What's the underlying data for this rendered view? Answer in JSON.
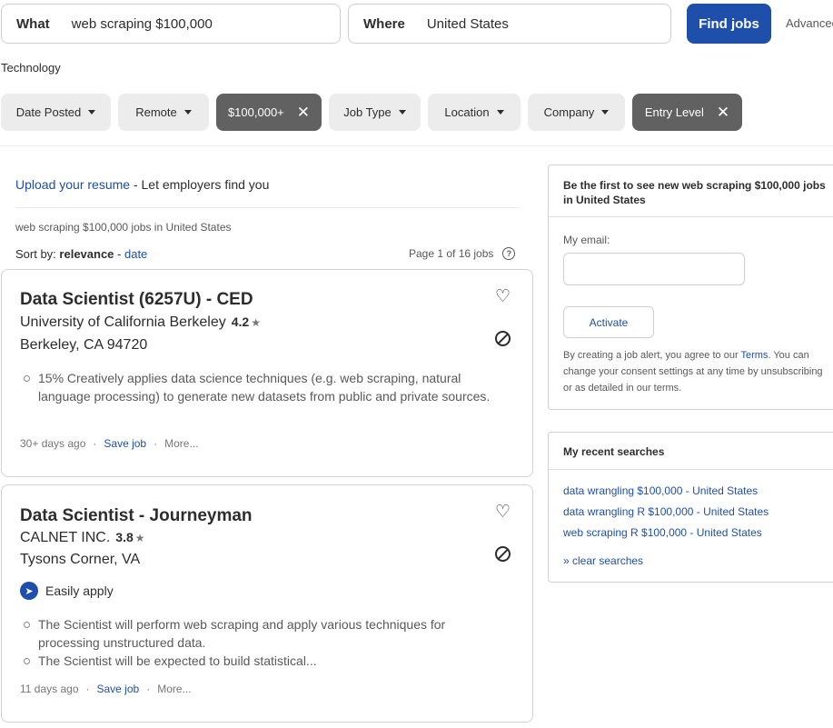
{
  "search": {
    "what_label": "What",
    "what_value": "web scraping $100,000",
    "where_label": "Where",
    "where_value": "United States",
    "find_button": "Find jobs",
    "advanced_link": "Advanced"
  },
  "category": "Technology",
  "filters": [
    {
      "label": "Date Posted",
      "active": false
    },
    {
      "label": "Remote",
      "active": false
    },
    {
      "label": "$100,000+",
      "active": true
    },
    {
      "label": "Job Type",
      "active": false
    },
    {
      "label": "Location",
      "active": false
    },
    {
      "label": "Company",
      "active": false
    },
    {
      "label": "Entry Level",
      "active": true
    }
  ],
  "upload": {
    "link": "Upload your resume",
    "rest": " - Let employers find you"
  },
  "results_summary": "web scraping $100,000 jobs in United States",
  "sort": {
    "prefix": "Sort by: ",
    "current": "relevance",
    "sep": " - ",
    "alt": "date"
  },
  "page_info": "Page 1 of 16 jobs",
  "jobs": [
    {
      "title": "Data Scientist (6257U) - CED",
      "company": "University of California Berkeley",
      "rating": "4.2",
      "location": "Berkeley, CA 94720",
      "bullets": [
        "15% Creatively applies data science techniques (e.g. web scraping, natural language processing) to generate new datasets from public and private sources."
      ],
      "posted": "30+ days ago",
      "save": "Save job",
      "more": "More..."
    },
    {
      "title": "Data Scientist - Journeyman",
      "company": "CALNET INC.",
      "rating": "3.8",
      "location": "Tysons Corner, VA",
      "easy_apply": "Easily apply",
      "bullets": [
        "The Scientist will perform web scraping and apply various techniques for processing unstructured data.",
        "The Scientist will be expected to build statistical..."
      ],
      "posted": "11 days ago",
      "save": "Save job",
      "more": "More..."
    }
  ],
  "alert": {
    "heading": "Be the first to see new web scraping $100,000 jobs in United States",
    "email_label": "My email:",
    "activate": "Activate",
    "terms_pre": "By creating a job alert, you agree to our ",
    "terms_link": "Terms",
    "terms_post": ". You can change your consent settings at any time by unsubscribing or as detailed in our terms."
  },
  "recent": {
    "heading": "My recent searches",
    "items": [
      "data wrangling $100,000 - United States",
      "data wrangling R $100,000 - United States",
      "web scraping R $100,000 - United States"
    ],
    "clear": "» clear searches"
  },
  "colors": {
    "brand": "#1e4faa",
    "chip_active": "#616161",
    "chip": "#ececec"
  }
}
